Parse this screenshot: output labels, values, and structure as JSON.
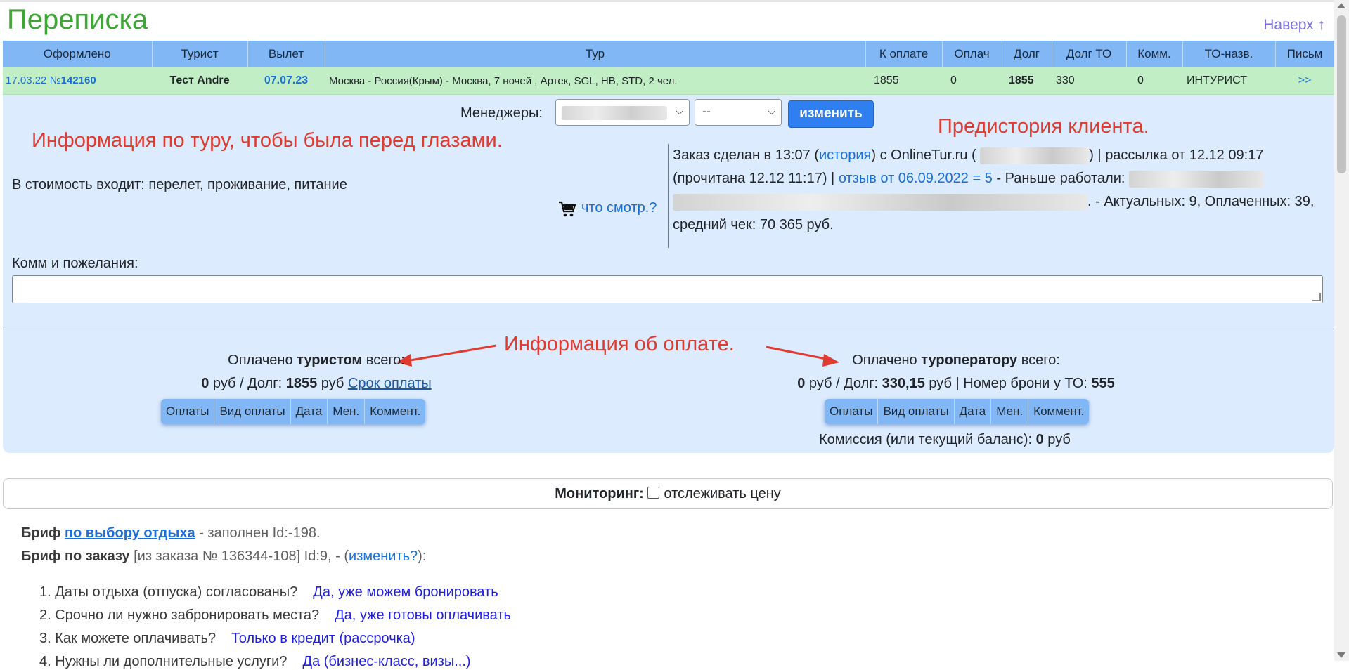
{
  "header": {
    "title": "Переписка",
    "to_top": "Наверх ↑"
  },
  "table": {
    "headers": [
      "Оформлено",
      "Турист",
      "Вылет",
      "Тур",
      "К оплате",
      "Оплач",
      "Долг",
      "Долг ТО",
      "Комм.",
      "ТО-назв.",
      "Письм"
    ],
    "row": {
      "date": "17.03.22",
      "num_prefix": "№",
      "num": "142160",
      "tourist": "Тест Andre",
      "departure": "07.07.23",
      "tour": "Москва - Россия(Крым) - Москва, 7 ночей , Артек, SGL, HB, STD,",
      "tour_people": "2 чел.",
      "to_pay": "1855",
      "paid": "0",
      "debt": "1855",
      "debt_to": "330",
      "comm": "0",
      "to_name": "ИНТУРИСТ",
      "letters": ">>"
    }
  },
  "managers": {
    "label": "Менеджеры:",
    "second_select": "--",
    "change_button": "изменить"
  },
  "annotations": {
    "tour_info": "Информация по туру, чтобы была перед глазами.",
    "history": "Предистория клиента.",
    "payment": "Информация об оплате."
  },
  "included": "В стоимость входит: перелет, проживание, питание",
  "look_link": "что смотр.?",
  "history": {
    "p1": "Заказ сделан в 13:07 (",
    "link_history": "история",
    "p2": ") с OnlineTur.ru (",
    "p3": ") | рассылка от 12.12 09:17 (прочитана 12.12 11:17) |",
    "link_review": "отзыв от 06.09.2022 = 5",
    "p4": "- Раньше работали:",
    "p5": ". - Актуальных: 9, Оплаченных: 39, средний чек: 70 365 руб."
  },
  "comments_label": "Комм и пожелания:",
  "tourist_payment": {
    "line1_pre": "Оплачено ",
    "line1_bold": "туристом",
    "line1_post": " всего:",
    "amount": "0",
    "rub_debt": " руб / Долг: ",
    "debt": "1855",
    "rub": " руб ",
    "deadline_link": "Срок оплаты",
    "cols": [
      "Оплаты",
      "Вид оплаты",
      "Дата",
      "Мен.",
      "Коммент."
    ]
  },
  "operator_payment": {
    "line1_pre": "Оплачено ",
    "line1_bold": "туроператору",
    "line1_post": " всего:",
    "amount": "0",
    "rub_debt": " руб / Долг: ",
    "debt": "330,15",
    "rub_booking": " руб | Номер брони у ТО: ",
    "booking": "555",
    "cols": [
      "Оплаты",
      "Вид оплаты",
      "Дата",
      "Мен.",
      "Коммент."
    ]
  },
  "commission": {
    "label": "Комиссия (или текущий баланс): ",
    "value": "0",
    "unit": " руб"
  },
  "monitoring": {
    "label": "Мониторинг:",
    "checkbox_label": "отслеживать цену"
  },
  "brief": {
    "line1_label": "Бриф",
    "line1_link": "по выбору отдыха",
    "line1_rest": " - заполнен Id:-198.",
    "line2_label": "Бриф по заказу",
    "line2_rest": " [из заказа № 136344-108] Id:9, - (",
    "line2_link": "изменить?",
    "line2_end": "):"
  },
  "questions": [
    {
      "q": "1. Даты отдыха (отпуска) согласованы?",
      "a": "Да, уже можем бронировать"
    },
    {
      "q": "2. Срочно ли нужно забронировать места?",
      "a": "Да, уже готовы оплачивать"
    },
    {
      "q": "3. Как можете оплачивать?",
      "a": "Только в кредит (рассрочка)"
    },
    {
      "q": "4. Нужны ли дополнительные услуги?",
      "a": "Да (бизнес-класс, визы...)"
    }
  ],
  "colors": {
    "title": "#3fa537",
    "header_bg": "#82b7f5",
    "row_bg": "#c2eec6",
    "panel_bg": "#dcebfd",
    "annotation": "#e13a2e",
    "button": "#2f7ff0"
  }
}
